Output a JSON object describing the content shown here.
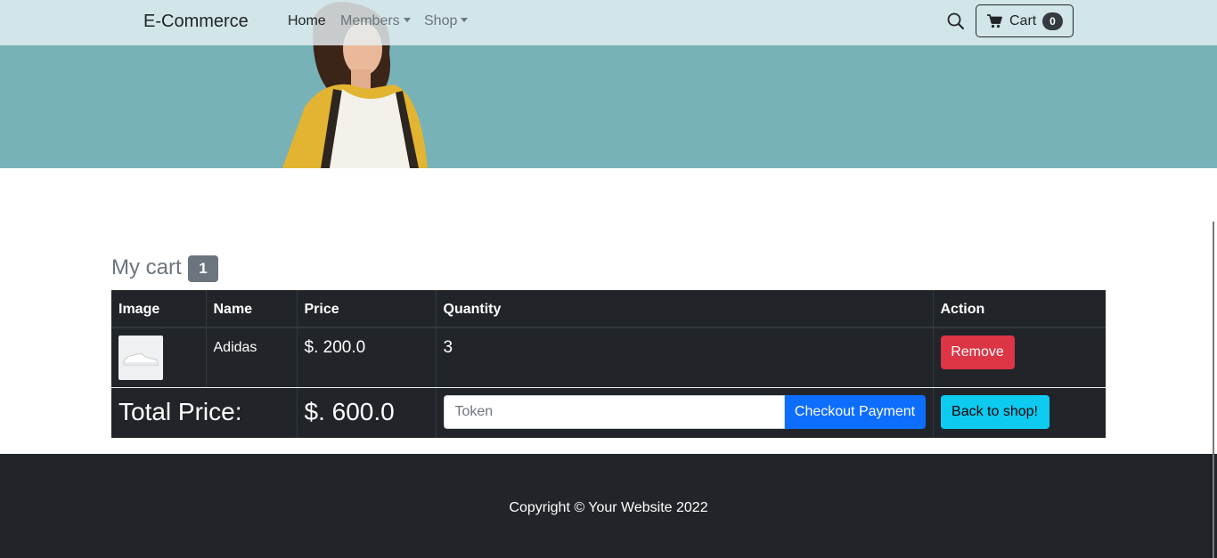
{
  "navbar": {
    "brand": "E-Commerce",
    "links": {
      "home": "Home",
      "members": "Members",
      "shop": "Shop"
    },
    "cart_label": "Cart",
    "cart_count": "0"
  },
  "cart": {
    "title": "My cart",
    "count_badge": "1",
    "columns": {
      "image": "Image",
      "name": "Name",
      "price": "Price",
      "quantity": "Quantity",
      "action": "Action"
    },
    "items": [
      {
        "name": "Adidas",
        "price": "$. 200.0",
        "quantity": "3",
        "action_label": "Remove"
      }
    ],
    "total_label": "Total Price:",
    "total_value": "$. 600.0",
    "token_placeholder": "Token",
    "checkout_label": "Checkout Payment",
    "back_label": "Back to shop!"
  },
  "footer": {
    "copyright": "Copyright © Your Website 2022"
  },
  "colors": {
    "hero_bg": "#77b2b8",
    "remove": "#dc3545",
    "checkout": "#0d6efd",
    "back": "#0dcaf0",
    "dark": "#212529"
  },
  "icons": {
    "search": "search-icon",
    "cart": "shopping-cart-icon"
  }
}
